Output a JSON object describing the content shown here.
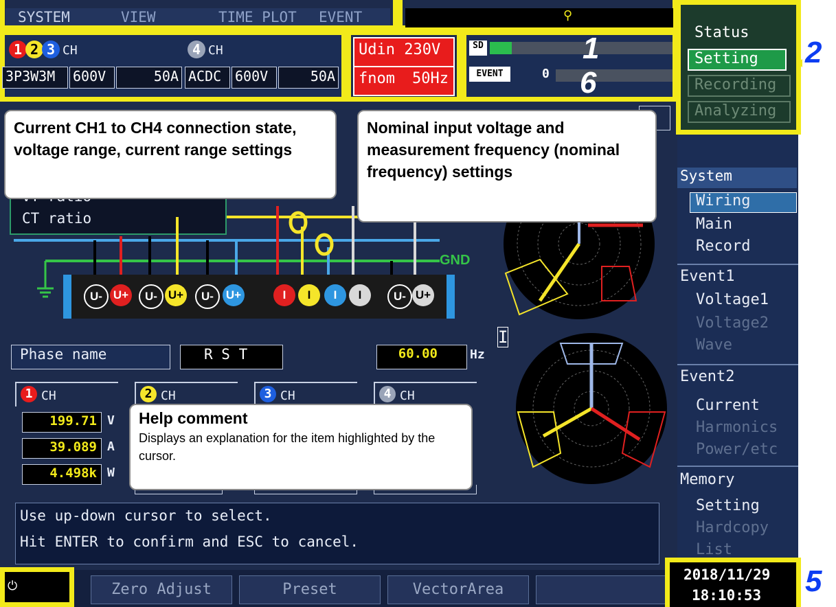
{
  "tabs": [
    "SYSTEM",
    "VIEW",
    "TIME PLOT",
    "EVENT"
  ],
  "status_menu": {
    "status": "Status",
    "setting": "Setting",
    "recording": "Recording",
    "analyzing": "Analyzing"
  },
  "channel_header": {
    "group1": "CH",
    "group4": "CH",
    "wiring": "3P3W3M",
    "v_range": "600V",
    "i_range": "50A",
    "ch4_mode": "ACDC",
    "ch4_v_range": "600V",
    "ch4_i_range": "50A"
  },
  "nominal": {
    "udin": "Udin 230V",
    "fnom_label": "fnom",
    "fnom_value": "50Hz"
  },
  "indicators": {
    "sd_label": "SD",
    "event_label": "EVENT",
    "event_count": "0",
    "sd_fill": 0.12
  },
  "ratio_box": {
    "vt": "VT ratio",
    "ct": "CT ratio"
  },
  "gnd_label": "GND",
  "terminals": [
    "U-",
    "U+",
    "U-",
    "U+",
    "U-",
    "U+",
    "I",
    "I",
    "I",
    "I",
    "U-",
    "U+"
  ],
  "phase": {
    "label": "Phase name",
    "value": "R S T",
    "freq": "60.00",
    "freq_unit": "Hz"
  },
  "vector_label": "I",
  "ch_tabs": [
    "CH",
    "CH",
    "CH",
    "CH"
  ],
  "ch_nums": [
    "1",
    "2",
    "3",
    "4"
  ],
  "ch1_values": [
    {
      "value": "199.71",
      "unit": "V"
    },
    {
      "value": "39.089",
      "unit": "A"
    },
    {
      "value": "4.498k",
      "unit": "W"
    }
  ],
  "help_text": [
    "Use up-down cursor to select.",
    "Hit ENTER to confirm and ESC to cancel."
  ],
  "side_menu": {
    "system": "System",
    "wiring": "Wiring",
    "main": "Main",
    "record": "Record",
    "event1": "Event1",
    "voltage1": "Voltage1",
    "voltage2": "Voltage2",
    "wave": "Wave",
    "event2": "Event2",
    "current": "Current",
    "harmonics": "Harmonics",
    "power": "Power/etc",
    "memory": "Memory",
    "mem_setting": "Setting",
    "hardcopy": "Hardcopy",
    "list": "List"
  },
  "fkeys": [
    "Zero Adjust",
    "Preset",
    "VectorArea"
  ],
  "datetime": {
    "date": "2018/11/29",
    "time": "18:10:53"
  },
  "callouts": {
    "channel": "Current CH1 to CH4 connection state, voltage range, current range settings",
    "nominal": "Nominal input voltage and measurement frequency (nominal frequency) settings",
    "help_title": "Help comment",
    "help_body": "Displays an explanation for the item highlighted by the cursor."
  },
  "numbers": [
    "1",
    "2",
    "5",
    "6"
  ],
  "colors": {
    "yellow_box": "#f2ea1a",
    "accent_blue": "#0d3df2",
    "menu_green": "#1a7a3c",
    "red_box": "#e81c1c",
    "phase_red": "#e02020",
    "phase_yellow": "#f5e52a",
    "phase_blue": "#4aa8e8"
  }
}
